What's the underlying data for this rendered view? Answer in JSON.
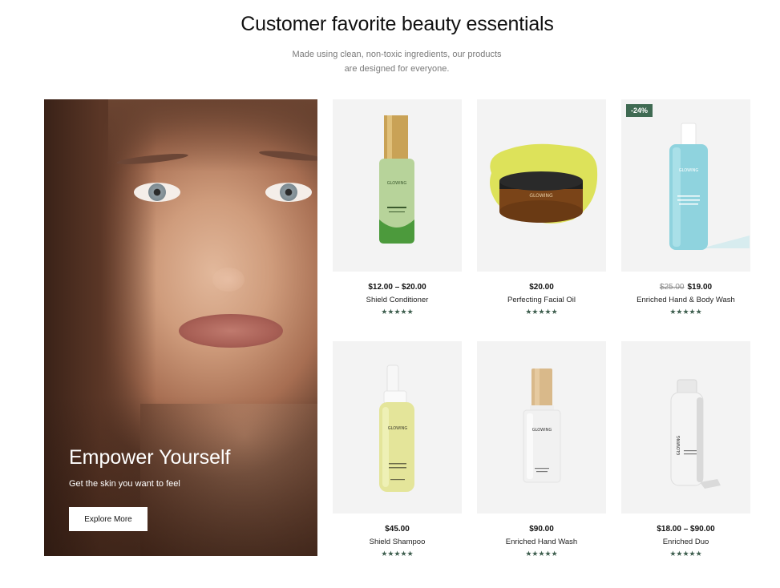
{
  "section": {
    "title": "Customer favorite beauty essentials",
    "subtitle_line1": "Made using clean, non-toxic ingredients, our products",
    "subtitle_line2": "are designed for everyone."
  },
  "hero": {
    "title": "Empower Yourself",
    "subtitle": "Get the skin you want to feel",
    "button_label": "Explore More"
  },
  "brand_label": "GLOWING",
  "products": [
    {
      "name": "Shield Conditioner",
      "price": "$12.00 – $20.00",
      "old_price": "",
      "badge": "",
      "rating_stars": "★★★★★",
      "rating": 5
    },
    {
      "name": "Perfecting Facial Oil",
      "price": "$20.00",
      "old_price": "",
      "badge": "",
      "rating_stars": "★★★★★",
      "rating": 5
    },
    {
      "name": "Enriched Hand & Body Wash",
      "price": "$19.00",
      "old_price": "$25.00",
      "badge": "-24%",
      "rating_stars": "★★★★★",
      "rating": 5
    },
    {
      "name": "Shield Shampoo",
      "price": "$45.00",
      "old_price": "",
      "badge": "",
      "rating_stars": "★★★★★",
      "rating": 5
    },
    {
      "name": "Enriched Hand Wash",
      "price": "$90.00",
      "old_price": "",
      "badge": "",
      "rating_stars": "★★★★★",
      "rating": 5
    },
    {
      "name": "Enriched Duo",
      "price": "$18.00 – $90.00",
      "old_price": "",
      "badge": "",
      "rating_stars": "★★★★★",
      "rating": 5
    }
  ],
  "colors": {
    "accent_green": "#3f6a52",
    "card_bg": "#f3f3f3"
  }
}
